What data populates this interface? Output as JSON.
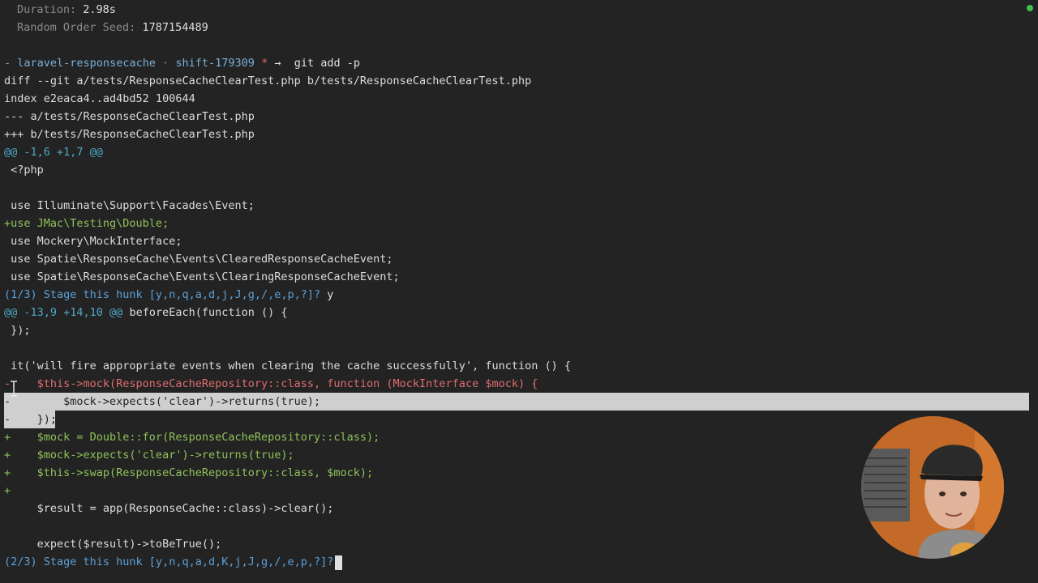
{
  "summary": {
    "duration_label": "Duration:",
    "duration_value": "2.98s",
    "seed_label": "Random Order Seed:",
    "seed_value": "1787154489"
  },
  "prompt": {
    "dash": "-",
    "repo": "laravel-responsecache",
    "separator": "·",
    "branch": "shift-179309",
    "dirty": "*",
    "arrow": "→",
    "command": "git add -p"
  },
  "diff": {
    "header": "diff --git a/tests/ResponseCacheClearTest.php b/tests/ResponseCacheClearTest.php",
    "index": "index e2eaca4..ad4bd52 100644",
    "from_file": "--- a/tests/ResponseCacheClearTest.php",
    "to_file": "+++ b/tests/ResponseCacheClearTest.php"
  },
  "hunk1": {
    "header": "@@ -1,6 +1,7 @@",
    "lines": [
      " <?php",
      "",
      " use Illuminate\\Support\\Facades\\Event;",
      "+use JMac\\Testing\\Double;",
      " use Mockery\\MockInterface;",
      " use Spatie\\ResponseCache\\Events\\ClearedResponseCacheEvent;",
      " use Spatie\\ResponseCache\\Events\\ClearingResponseCacheEvent;"
    ],
    "stage_prompt": "(1/3) Stage this hunk [y,n,q,a,d,j,J,g,/,e,p,?]?",
    "answer": "y"
  },
  "hunk2": {
    "header": "@@ -13,9 +14,10 @@",
    "header_context": "beforeEach(function () {",
    "context_before": [
      " });",
      "",
      " it('will fire appropriate events when clearing the cache successfully', function () {"
    ],
    "removed": [
      "-    $this->mock(ResponseCacheRepository::class, function (MockInterface $mock) {",
      "-        $mock->expects('clear')->returns(true);",
      "-    });"
    ],
    "added": [
      "+    $mock = Double::for(ResponseCacheRepository::class);",
      "+    $mock->expects('clear')->returns(true);",
      "+    $this->swap(ResponseCacheRepository::class, $mock);",
      "+"
    ],
    "context_after": [
      "     $result = app(ResponseCache::class)->clear();",
      "",
      "     expect($result)->toBeTrue();"
    ],
    "stage_prompt": "(2/3) Stage this hunk [y,n,q,a,d,K,j,J,g,/,e,p,?]?"
  },
  "colors": {
    "background": "#232323",
    "added": "#8fc25a",
    "removed": "#e06c6c",
    "hunk_header": "#4fa8c8",
    "selection": "#cfcfcf",
    "status_dot": "#3fbf4f"
  },
  "icons": {
    "text_cursor": "i-beam-cursor-icon",
    "terminal_cursor": "block-cursor-icon",
    "status": "status-dot-icon"
  }
}
